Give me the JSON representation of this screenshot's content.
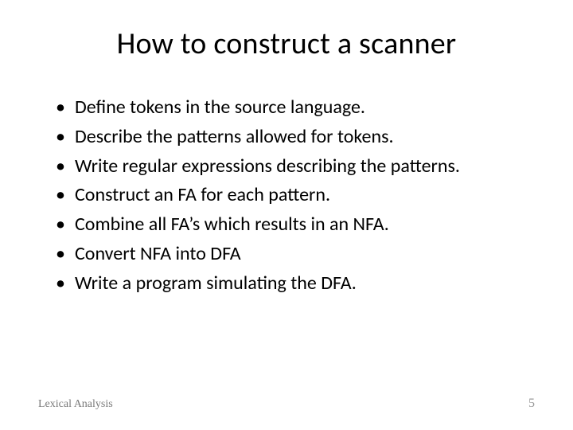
{
  "title": "How to construct a scanner",
  "bullets": [
    "Define tokens in the source language.",
    "Describe the patterns allowed for tokens.",
    "Write regular expressions describing the patterns.",
    "Construct an FA for each pattern.",
    "Combine all FA’s which results in an NFA.",
    "Convert NFA into DFA",
    "Write a program simulating the DFA."
  ],
  "footer": {
    "left": "Lexical Analysis",
    "page": "5"
  }
}
